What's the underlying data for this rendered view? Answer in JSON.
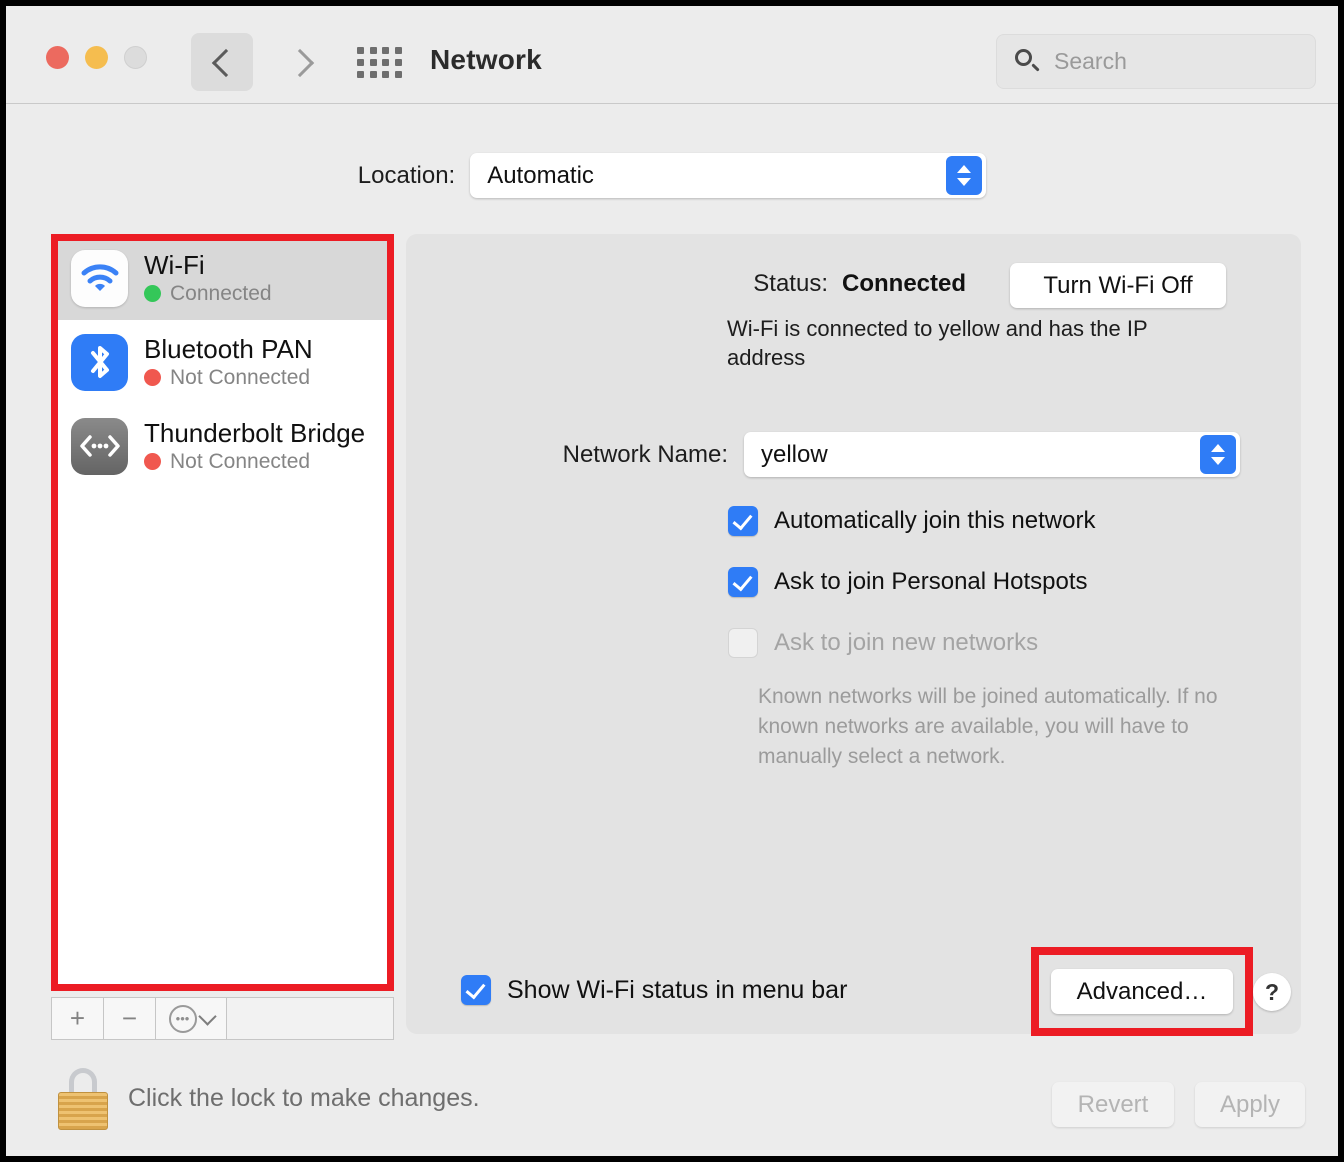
{
  "window": {
    "title": "Network",
    "traffic_lights": [
      "close",
      "minimize",
      "zoom"
    ],
    "back_icon": "chevron-left-icon",
    "forward_icon": "chevron-right-icon",
    "grid_icon": "show-all-grid-icon"
  },
  "search": {
    "placeholder": "Search",
    "icon": "search-icon",
    "value": ""
  },
  "location": {
    "label": "Location:",
    "value": "Automatic"
  },
  "sidebar": {
    "services": [
      {
        "name": "Wi-Fi",
        "status": "Connected",
        "status_color": "#34c759",
        "icon": "wifi-icon",
        "selected": true
      },
      {
        "name": "Bluetooth PAN",
        "status": "Not Connected",
        "status_color": "#f0584f",
        "icon": "bluetooth-icon",
        "selected": false
      },
      {
        "name": "Thunderbolt Bridge",
        "status": "Not Connected",
        "status_color": "#f0584f",
        "icon": "thunderbolt-icon",
        "selected": false
      }
    ],
    "toolbar": {
      "add_label": "+",
      "remove_label": "−",
      "actions_icon": "ellipsis-circle-icon"
    },
    "highlight_color": "#ec1c24"
  },
  "main": {
    "status_label": "Status:",
    "status_value": "Connected",
    "turn_off_label": "Turn Wi-Fi Off",
    "status_description": "Wi-Fi is connected to yellow and has the IP address",
    "network_name_label": "Network Name:",
    "network_name_value": "yellow",
    "checkboxes": [
      {
        "label": "Automatically join this network",
        "checked": true,
        "enabled": true
      },
      {
        "label": "Ask to join Personal Hotspots",
        "checked": true,
        "enabled": true
      },
      {
        "label": "Ask to join new networks",
        "checked": false,
        "enabled": false
      }
    ],
    "hint": "Known networks will be joined automatically. If no known networks are available, you will have to manually select a network.",
    "show_status_label": "Show Wi-Fi status in menu bar",
    "show_status_checked": true,
    "advanced_label": "Advanced…",
    "help_label": "?",
    "advanced_highlight_color": "#ec1c24"
  },
  "footer": {
    "lock_icon": "lock-closed-icon",
    "lock_text": "Click the lock to make changes.",
    "revert_label": "Revert",
    "apply_label": "Apply"
  }
}
